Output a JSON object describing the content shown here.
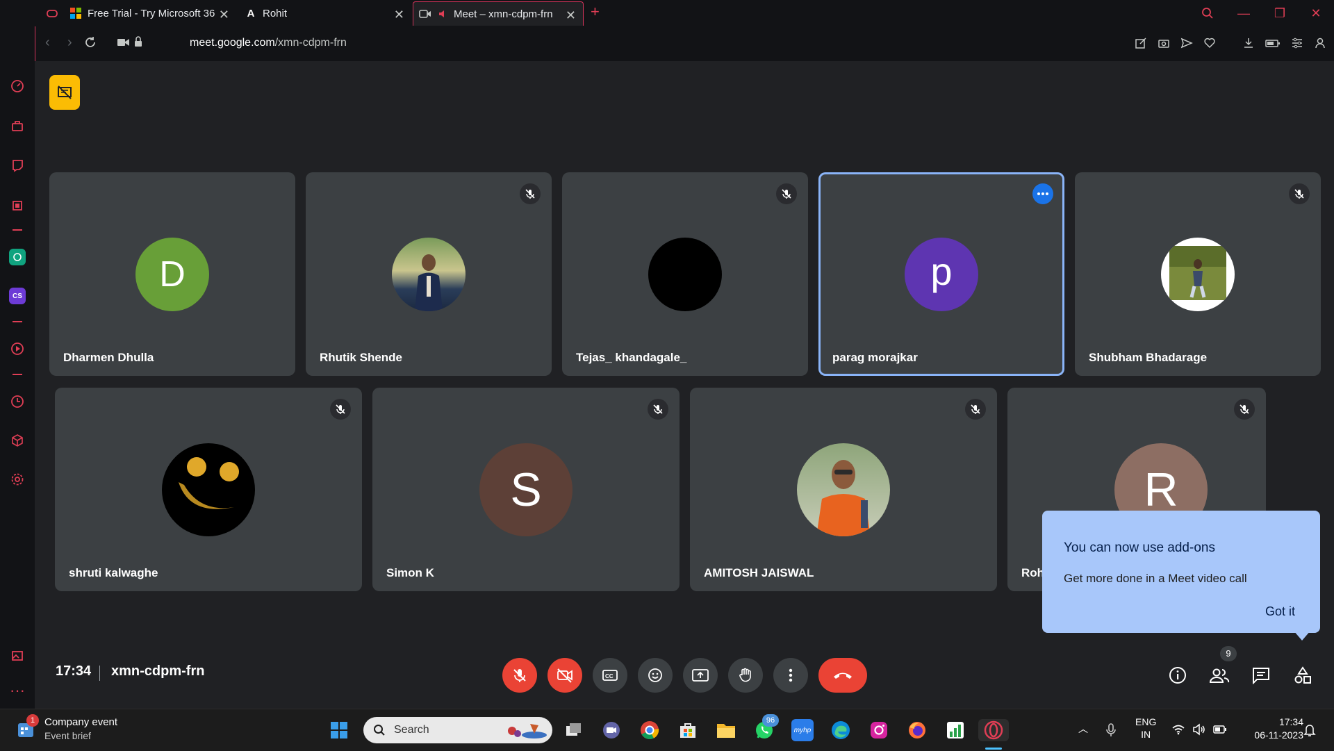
{
  "browser": {
    "tabs": [
      {
        "label": "Free Trial - Try Microsoft 36",
        "icon": "microsoft-icon"
      },
      {
        "label": "Rohit",
        "icon": "a-logo-icon"
      },
      {
        "label": "Meet – xmn-cdpm-frn",
        "icon": "meet-icon",
        "active": true
      }
    ],
    "url_prefix": "meet.google.com",
    "url_suffix": "/xmn-cdpm-frn",
    "accent_color": "#d4335a"
  },
  "meet": {
    "participants_row1": [
      {
        "name": "Dharmen Dhulla",
        "initial": "D",
        "color": "#689f38",
        "muted": false
      },
      {
        "name": "Rhutik Shende",
        "photo": true,
        "muted": true
      },
      {
        "name": "Tejas_ khandagale_",
        "color": "#000000",
        "muted": true
      },
      {
        "name": "parag morajkar",
        "initial": "p",
        "color": "#5e35b1",
        "active": true
      },
      {
        "name": "Shubham Bhadarage",
        "photo": true,
        "muted": true
      }
    ],
    "participants_row2": [
      {
        "name": "shruti kalwaghe",
        "smiley": true,
        "muted": true
      },
      {
        "name": "Simon K",
        "initial": "S",
        "color": "#5d4037",
        "muted": true
      },
      {
        "name": "AMITOSH JAISWAL",
        "photo": true,
        "muted": true
      },
      {
        "name": "Roh",
        "initial": "R",
        "color": "#8d6e63",
        "muted": true
      }
    ],
    "time": "17:34",
    "meeting_code": "xmn-cdpm-frn",
    "people_count": "9",
    "popup": {
      "title": "You can now use add-ons",
      "description": "Get more done in a Meet video call",
      "button": "Got it"
    }
  },
  "taskbar": {
    "notification": {
      "title": "Company event",
      "subtitle": "Event brief",
      "badge": "1"
    },
    "search_placeholder": "Search",
    "whatsapp_badge": "96",
    "lang_line1": "ENG",
    "lang_line2": "IN",
    "clock_time": "17:34",
    "clock_date": "06-11-2023"
  }
}
